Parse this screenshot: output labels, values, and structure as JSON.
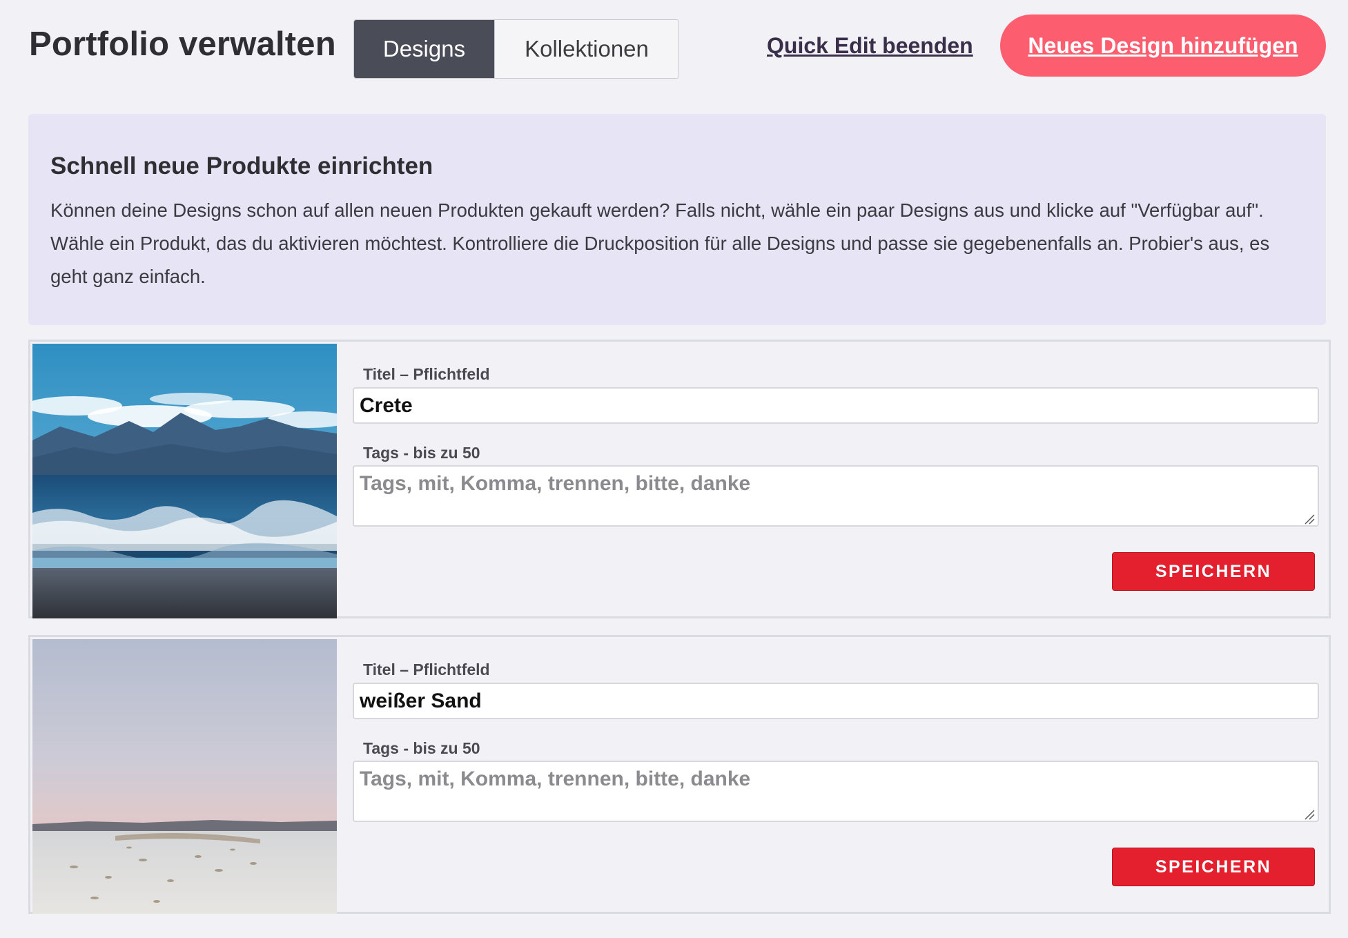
{
  "header": {
    "page_title": "Portfolio verwalten",
    "tabs": [
      {
        "label": "Designs",
        "active": true
      },
      {
        "label": "Kollektionen",
        "active": false
      }
    ],
    "quick_edit_label": "Quick Edit beenden",
    "new_design_label": "Neues Design hinzufügen"
  },
  "info": {
    "title": "Schnell neue Produkte einrichten",
    "text": "Können deine Designs schon auf allen neuen Produkten gekauft werden? Falls nicht, wähle ein paar Designs aus und klicke auf \"Verfügbar auf\". Wähle ein Produkt, das du aktivieren möchtest. Kontrolliere die Druckposition für alle Designs und passe sie gegebenenfalls an. Probier's aus, es geht ganz einfach."
  },
  "designs": [
    {
      "image": "sea-mountains-beach-photo",
      "title_label": "Titel – Pflichtfeld",
      "title_value": "Crete",
      "tags_label": "Tags - bis zu 50",
      "tags_value": "",
      "tags_placeholder": "Tags, mit, Komma, trennen, bitte, danke",
      "save_label": "SPEICHERN"
    },
    {
      "image": "white-sand-dunes-dusk-photo",
      "title_label": "Titel – Pflichtfeld",
      "title_value": "weißer Sand",
      "tags_label": "Tags - bis zu 50",
      "tags_value": "",
      "tags_placeholder": "Tags, mit, Komma, trennen, bitte, danke",
      "save_label": "SPEICHERN"
    }
  ],
  "colors": {
    "background": "#f2f1f6",
    "tab_active": "#4a4d57",
    "accent_pink": "#fc5e6f",
    "info_box": "#e7e4f5",
    "save_red": "#e4202e"
  }
}
